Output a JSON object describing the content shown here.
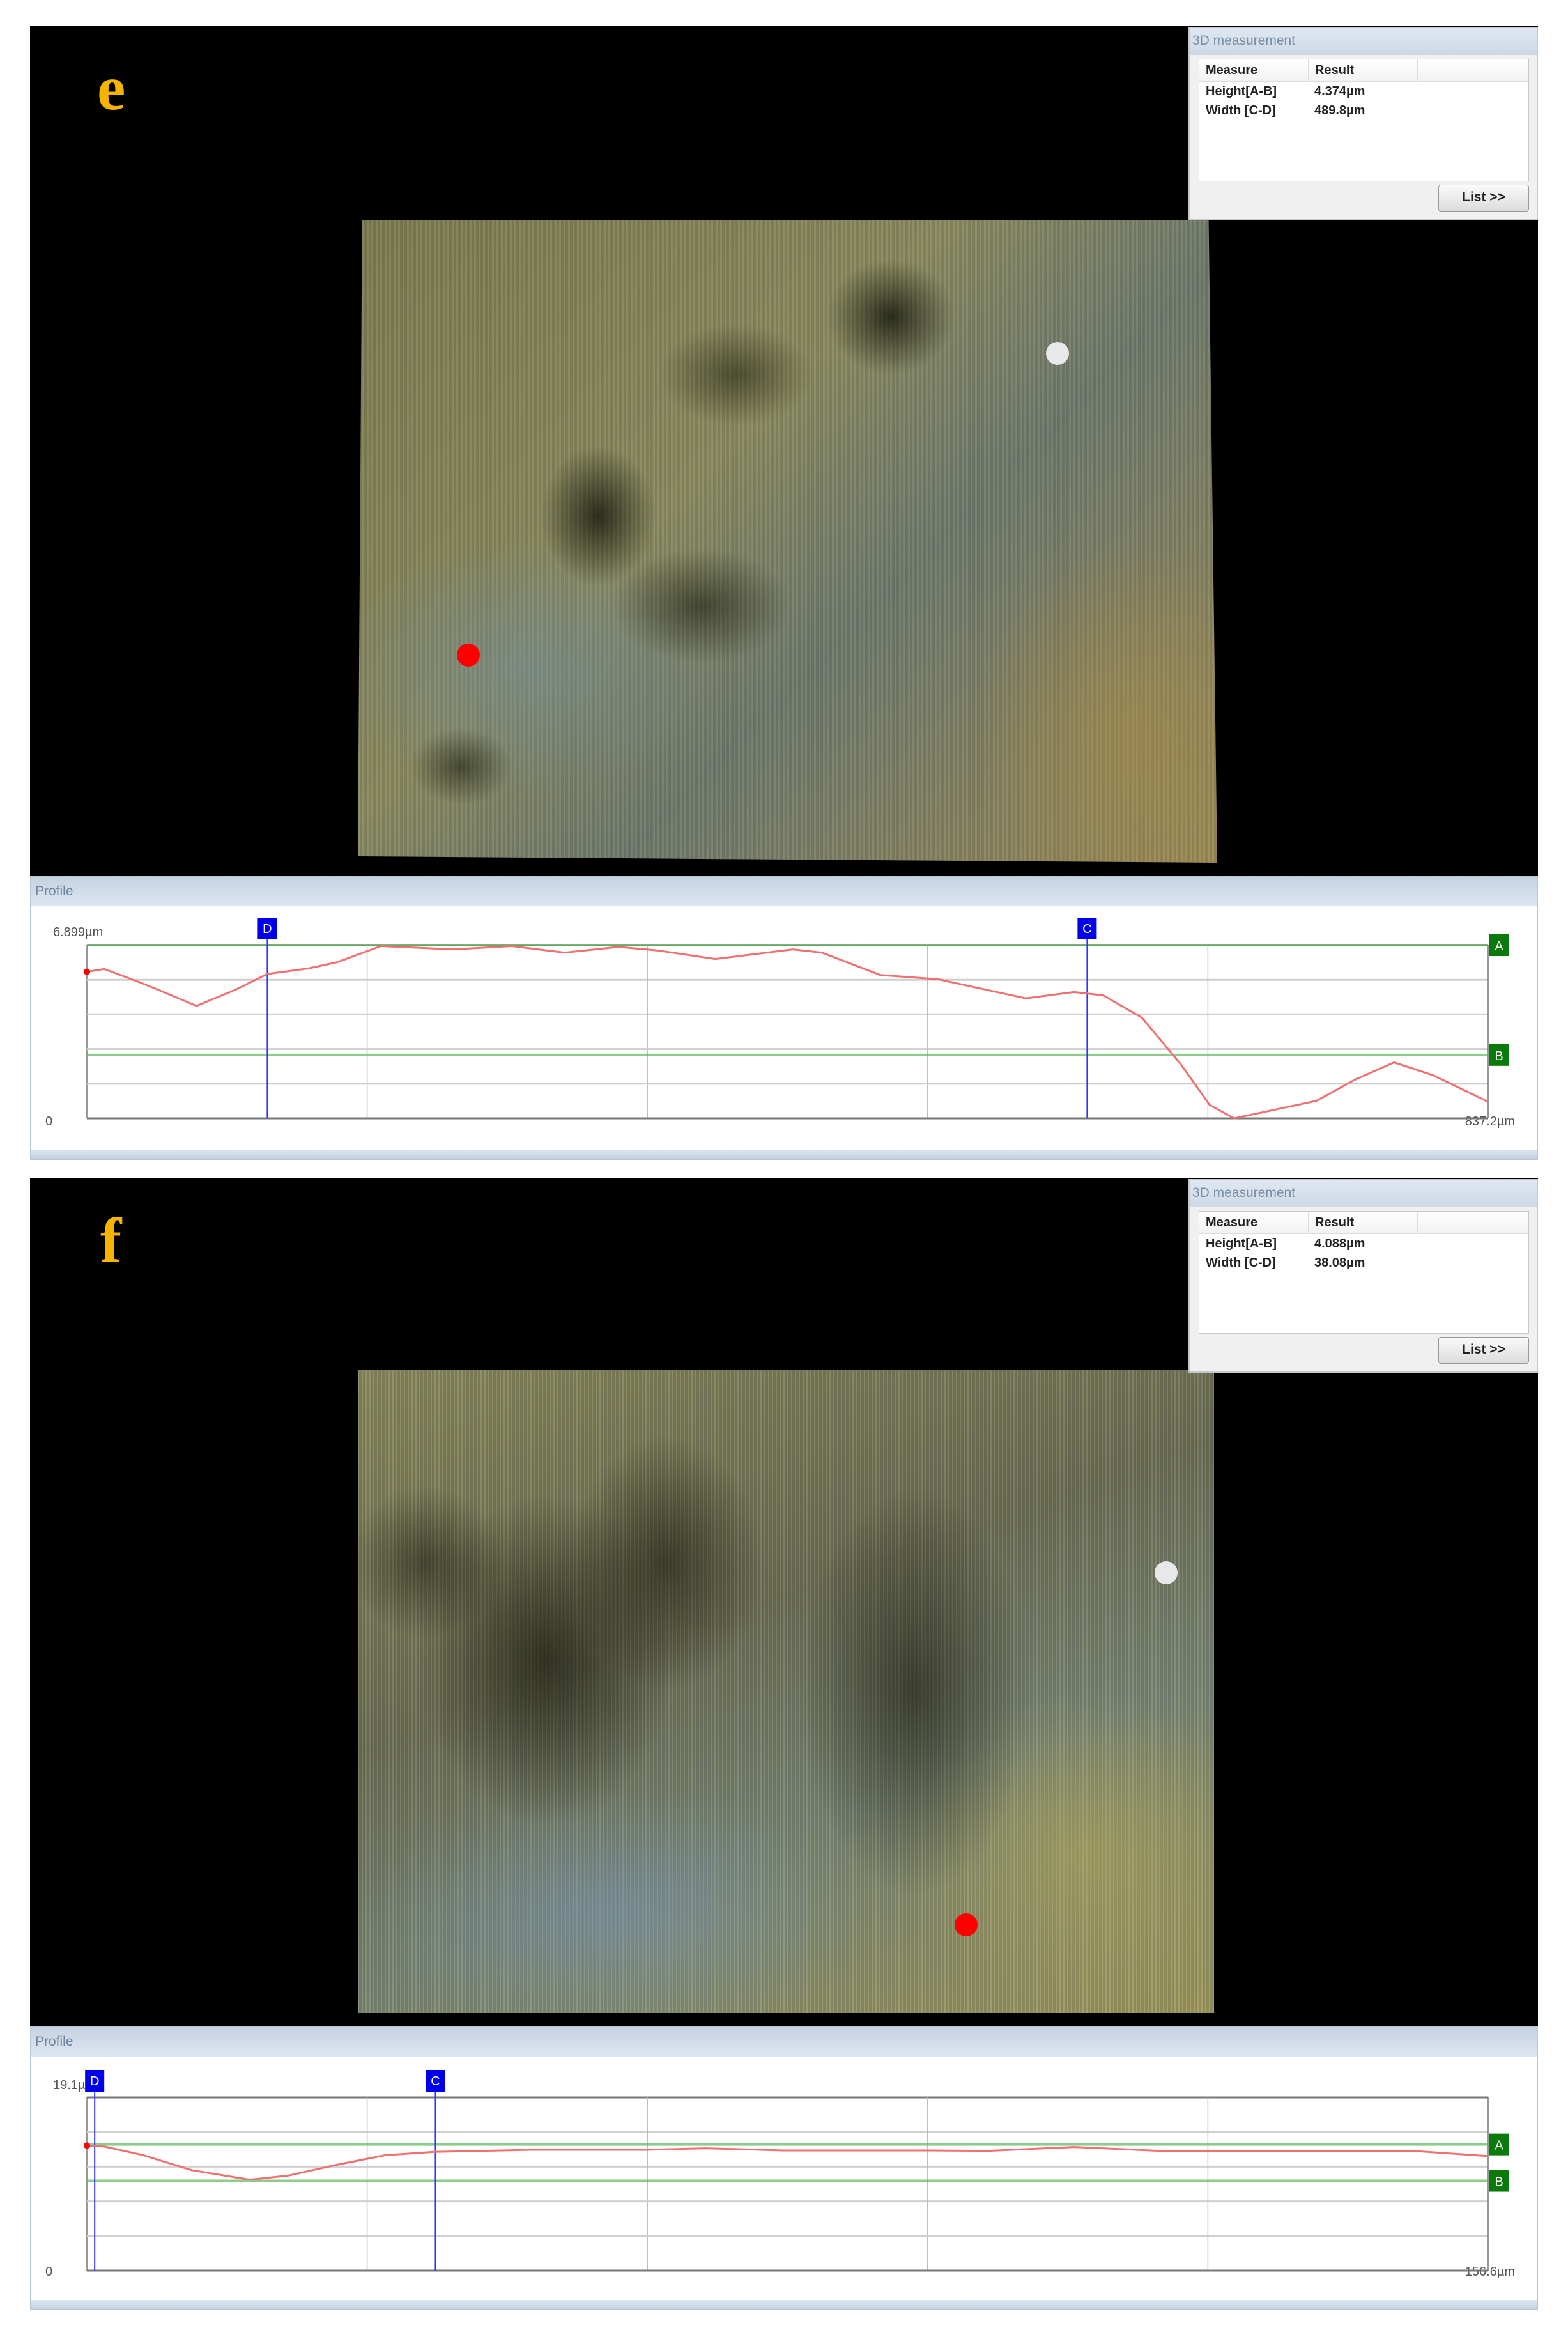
{
  "panels": [
    {
      "letter": "e",
      "measurement": {
        "title": "3D measurement",
        "headers": [
          "Measure",
          "Result"
        ],
        "rows": [
          {
            "measure": "Height[A-B]",
            "result": "4.374µm"
          },
          {
            "measure": "Width [C-D]",
            "result": "489.8µm"
          }
        ],
        "list_button": "List >>"
      },
      "profile": {
        "title": "Profile",
        "y_top_label": "6.899µm",
        "x_min_label": "0",
        "x_max_label": "837.2µm",
        "marker_labels": {
          "A": "A",
          "B": "B",
          "C": "C",
          "D": "D"
        }
      }
    },
    {
      "letter": "f",
      "measurement": {
        "title": "3D measurement",
        "headers": [
          "Measure",
          "Result"
        ],
        "rows": [
          {
            "measure": "Height[A-B]",
            "result": "4.088µm"
          },
          {
            "measure": "Width [C-D]",
            "result": "38.08µm"
          }
        ],
        "list_button": "List >>"
      },
      "profile": {
        "title": "Profile",
        "y_top_label": "19.1µm",
        "x_min_label": "0",
        "x_max_label": "156.6µm",
        "marker_labels": {
          "A": "A",
          "B": "B",
          "C": "C",
          "D": "D"
        }
      }
    }
  ],
  "colors": {
    "letter": "#f5b400",
    "curve": "#f07070",
    "ab_line": "#5cb85c",
    "cd_line": "#3333ff",
    "marker_blue": "#0000ee",
    "marker_green": "#0a7a0a",
    "red_point": "#ff0000",
    "white_point": "#e8e8e8"
  },
  "chart_data": [
    {
      "type": "line",
      "title": "Profile",
      "xlabel": "",
      "ylabel": "",
      "xlim": [
        0,
        837.2
      ],
      "ylim": [
        0,
        6.899
      ],
      "grid": true,
      "x": [
        0,
        10.4,
        33.6,
        65.5,
        88.7,
        107.8,
        132.1,
        149.5,
        175.6,
        219.0,
        253.8,
        285.6,
        317.5,
        340.7,
        375.5,
        421.8,
        439.2,
        474.0,
        508.7,
        531.9,
        560.9,
        589.8,
        607.2,
        630.4,
        653.6,
        670.9,
        685.4,
        717.3,
        734.7,
        757.9,
        781.0,
        804.2,
        837.2
      ],
      "y": [
        5.84,
        5.95,
        5.37,
        4.48,
        5.12,
        5.75,
        5.97,
        6.22,
        6.86,
        6.73,
        6.86,
        6.6,
        6.83,
        6.69,
        6.35,
        6.73,
        6.6,
        5.71,
        5.54,
        5.2,
        4.78,
        5.03,
        4.9,
        4.01,
        2.15,
        0.53,
        0,
        0.45,
        0.7,
        1.55,
        2.23,
        1.72,
        0.66
      ],
      "lines": {
        "A": 6.899,
        "B": 2.525,
        "C": 597.6,
        "D": 107.8
      }
    },
    {
      "type": "line",
      "title": "Profile",
      "xlabel": "",
      "ylabel": "",
      "xlim": [
        0,
        156.6
      ],
      "ylim": [
        0,
        19.1
      ],
      "grid": true,
      "x": [
        0,
        1.95,
        6.29,
        11.7,
        18.21,
        22.54,
        27.96,
        33.38,
        38.8,
        49.63,
        62.64,
        69.14,
        77.81,
        94.06,
        100.57,
        110.32,
        120.07,
        134.16,
        148.25,
        156.6
      ],
      "y": [
        13.79,
        13.68,
        12.73,
        11.08,
        10.02,
        10.49,
        11.67,
        12.73,
        13.09,
        13.32,
        13.32,
        13.49,
        13.25,
        13.25,
        13.2,
        13.63,
        13.2,
        13.2,
        13.2,
        12.62
      ],
      "lines": {
        "A": 13.91,
        "B": 9.9,
        "C": 38.95,
        "D": 0.87
      }
    }
  ]
}
